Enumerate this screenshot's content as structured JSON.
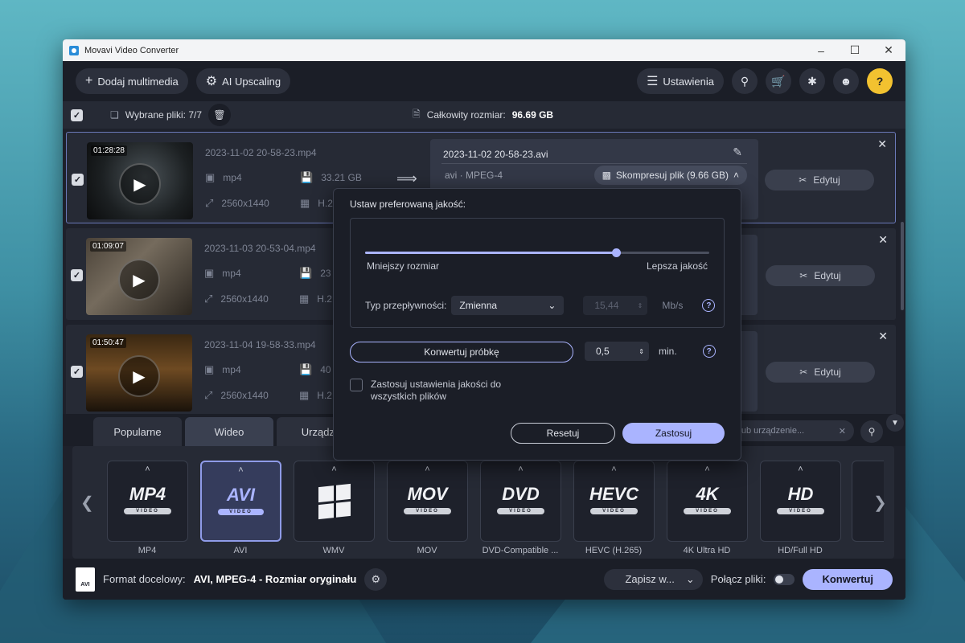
{
  "window": {
    "title": "Movavi Video Converter"
  },
  "toolbar": {
    "add_media": "Dodaj multimedia",
    "ai_upscaling": "AI Upscaling",
    "settings": "Ustawienia"
  },
  "selection": {
    "label": "Wybrane pliki: 7/7",
    "total_label": "Całkowity rozmiar:",
    "total_value": "96.69 GB"
  },
  "files": [
    {
      "duration": "01:28:28",
      "name": "2023-11-02 20-58-23.mp4",
      "format": "mp4",
      "size": "33.21 GB",
      "resolution": "2560x1440",
      "codec": "H.2"
    },
    {
      "duration": "01:09:07",
      "name": "2023-11-03 20-53-04.mp4",
      "format": "mp4",
      "size": "23",
      "resolution": "2560x1440",
      "codec": "H.2"
    },
    {
      "duration": "01:50:47",
      "name": "2023-11-04 19-58-33.mp4",
      "format": "mp4",
      "size": "40",
      "resolution": "2560x1440",
      "codec": "H.2"
    }
  ],
  "output": {
    "name": "2023-11-02 20-58-23.avi",
    "format": "avi · MPEG-4",
    "compress": "Skompresuj plik (9.66 GB)"
  },
  "edit_label": "Edytuj",
  "tabs": {
    "popular": "Popularne",
    "video": "Wideo",
    "devices": "Urządze"
  },
  "format_search_placeholder": "mat lub urządzenie...",
  "formats": [
    {
      "logo": "MP4",
      "sub": "VIDEO",
      "label": "MP4"
    },
    {
      "logo": "AVI",
      "sub": "VIDEO",
      "label": "AVI"
    },
    {
      "logo": "",
      "sub": "",
      "label": "WMV"
    },
    {
      "logo": "MOV",
      "sub": "VIDEO",
      "label": "MOV"
    },
    {
      "logo": "DVD",
      "sub": "VIDEO",
      "label": "DVD-Compatible ..."
    },
    {
      "logo": "HEVC",
      "sub": "VIDEO",
      "label": "HEVC (H.265)"
    },
    {
      "logo": "4K",
      "sub": "VIDEO",
      "label": "4K Ultra HD"
    },
    {
      "logo": "HD",
      "sub": "VIDEO",
      "label": "HD/Full HD"
    }
  ],
  "bottom": {
    "file_icon": "AVI",
    "target_label": "Format docelowy:",
    "target_value": "AVI, MPEG-4 - Rozmiar oryginału",
    "save_to": "Zapisz w...",
    "merge": "Połącz pliki:",
    "convert": "Konwertuj"
  },
  "quality_popup": {
    "title": "Ustaw preferowaną jakość:",
    "quality_level": 0.73,
    "min_label": "Mniejszy rozmiar",
    "max_label": "Lepsza jakość",
    "bitrate_type_label": "Typ przepływności:",
    "bitrate_type": "Zmienna",
    "bitrate_value": "15,44",
    "bitrate_unit": "Mb/s",
    "sample_button": "Konwertuj próbkę",
    "sample_value": "0,5",
    "sample_unit": "min.",
    "apply_all": "Zastosuj ustawienia jakości do wszystkich plików",
    "reset": "Resetuj",
    "apply": "Zastosuj"
  }
}
